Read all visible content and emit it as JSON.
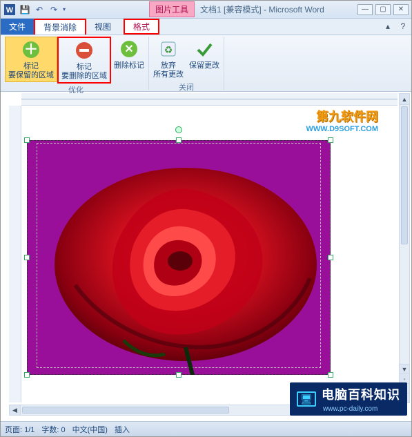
{
  "titlebar": {
    "context_tab": "图片工具",
    "doc_name": "文档1",
    "mode": "[兼容模式]",
    "app_name": "Microsoft Word"
  },
  "tabs": {
    "file": "文件",
    "bgremove": "背景消除",
    "view": "视图",
    "format": "格式"
  },
  "ribbon": {
    "mark_keep": {
      "l1": "标记",
      "l2": "要保留的区域"
    },
    "mark_remove": {
      "l1": "标记",
      "l2": "要删除的区域"
    },
    "delete_mark": "删除标记",
    "discard": {
      "l1": "放弃",
      "l2": "所有更改"
    },
    "keep": "保留更改",
    "group_refine": "优化",
    "group_close": "关闭"
  },
  "watermark1": {
    "top": "第九软件网",
    "bottom": "WWW.D9SOFT.COM"
  },
  "watermark2": {
    "text": "电脑百科知识",
    "sub": "www.pc-daily.com"
  },
  "status": {
    "page": "页面: 1/1",
    "words": "字数: 0",
    "lang": "中文(中国)",
    "insert": "插入"
  },
  "icons": {
    "word": "W",
    "save": "💾",
    "undo": "↶",
    "redo": "↷",
    "plus_green": "＋",
    "minus_red": "−",
    "recycle": "♻",
    "check": "✓",
    "monitor": "🖥"
  }
}
